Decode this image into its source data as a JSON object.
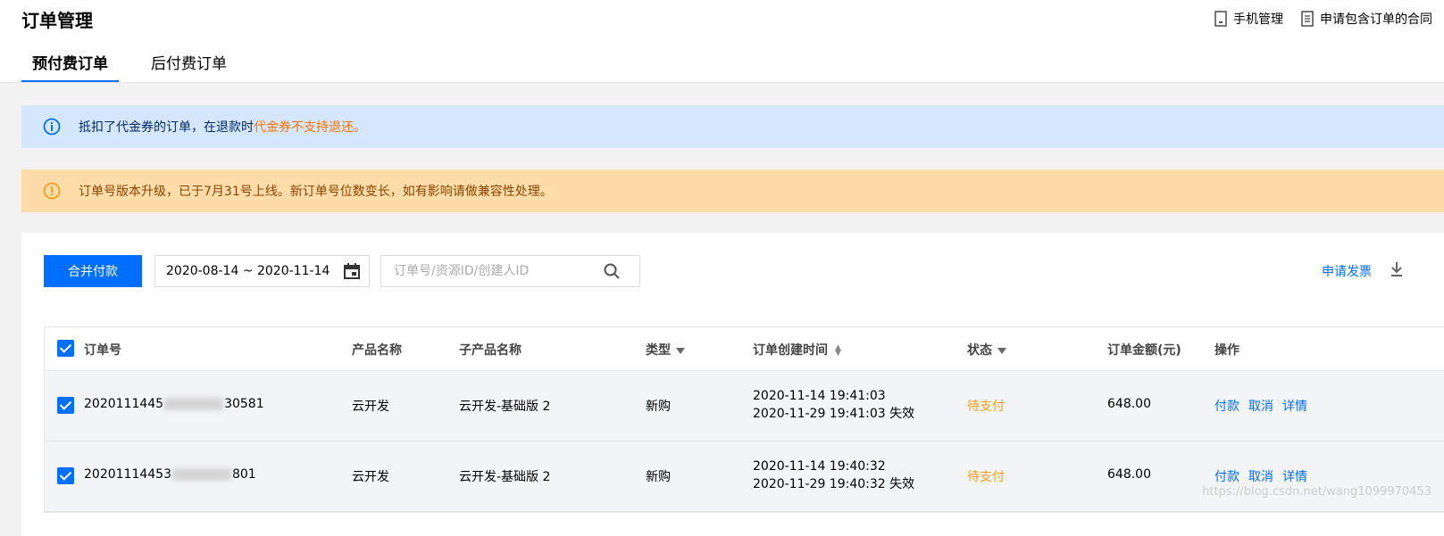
{
  "header": {
    "title": "订单管理",
    "actions": [
      {
        "label": "手机管理",
        "icon": "phone-icon"
      },
      {
        "label": "申请包含订单的合同",
        "icon": "document-icon"
      }
    ]
  },
  "tabs": [
    {
      "label": "预付费订单",
      "active": true
    },
    {
      "label": "后付费订单",
      "active": false
    }
  ],
  "notices": {
    "info": {
      "text": "抵扣了代金券的订单，在退款时",
      "highlight": "代金券不支持退还。",
      "color": "#d5e7ff"
    },
    "warning": {
      "text": "订单号版本升级，已于7月31号上线。新订单号位数变长，如有影响请做兼容性处理。",
      "color": "#ffdca8"
    }
  },
  "toolbar": {
    "merge_pay_label": "合并付款",
    "date_range": "2020-08-14 ~ 2020-11-14",
    "search_placeholder": "订单号/资源ID/创建人ID",
    "invoice_label": "申请发票"
  },
  "table": {
    "columns": {
      "order_id": "订单号",
      "product": "产品名称",
      "subproduct": "子产品名称",
      "type": "类型",
      "created": "订单创建时间",
      "status": "状态",
      "amount": "订单金额(元)",
      "actions": "操作"
    },
    "rows": [
      {
        "order_prefix": "2020111445",
        "order_suffix": "30581",
        "product": "云开发",
        "subproduct": "云开发-基础版 2",
        "type": "新购",
        "created": "2020-11-14 19:41:03",
        "expires": "2020-11-29 19:41:03 失效",
        "status": "待支付",
        "amount": "648.00",
        "ops": [
          "付款",
          "取消",
          "详情"
        ]
      },
      {
        "order_prefix": "20201114453",
        "order_suffix": "801",
        "product": "云开发",
        "subproduct": "云开发-基础版 2",
        "type": "新购",
        "created": "2020-11-14 19:40:32",
        "expires": "2020-11-29 19:40:32 失效",
        "status": "待支付",
        "amount": "648.00",
        "ops": [
          "付款",
          "取消",
          "详情"
        ]
      }
    ]
  },
  "watermark": "https://blog.csdn.net/wang1099970453",
  "colors": {
    "accent": "#006eff",
    "pending": "#ff9c19"
  }
}
